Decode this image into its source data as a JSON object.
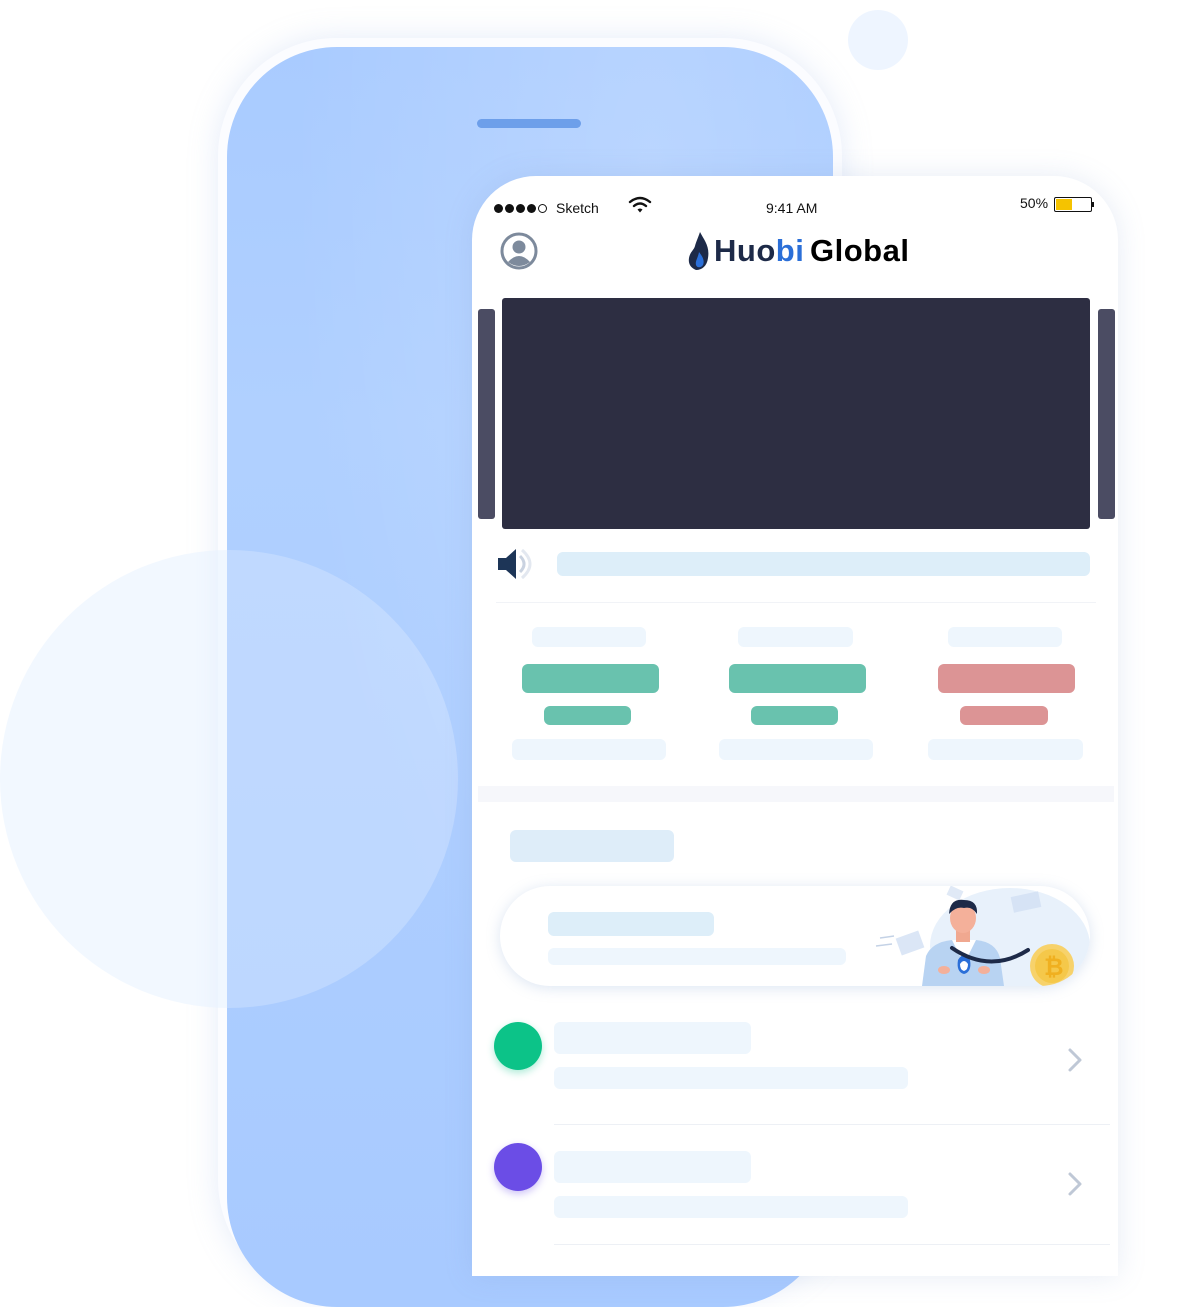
{
  "status_bar": {
    "carrier": "Sketch",
    "time": "9:41 AM",
    "battery_percent": "50%",
    "battery_level": 0.5
  },
  "header": {
    "logo_part1": "Huobi",
    "logo_part2": "Global",
    "avatar_icon": "user-avatar-icon",
    "logo_icon": "flame-logo-icon"
  },
  "tickers": [
    {
      "trend": "up",
      "color": "#69c2ae"
    },
    {
      "trend": "up",
      "color": "#69c2ae"
    },
    {
      "trend": "down",
      "color": "#dc9495"
    }
  ],
  "list": [
    {
      "dot_color": "#0cc388",
      "chevron_icon": "chevron-right-icon"
    },
    {
      "dot_color": "#6b4de6",
      "chevron_icon": "chevron-right-icon"
    }
  ],
  "colors": {
    "back_phone": "#a9cbff",
    "banner": "#2d2e42",
    "brand_navy": "#1d2a48",
    "brand_blue": "#2b6fd8",
    "up": "#69c2ae",
    "down": "#dc9495"
  }
}
